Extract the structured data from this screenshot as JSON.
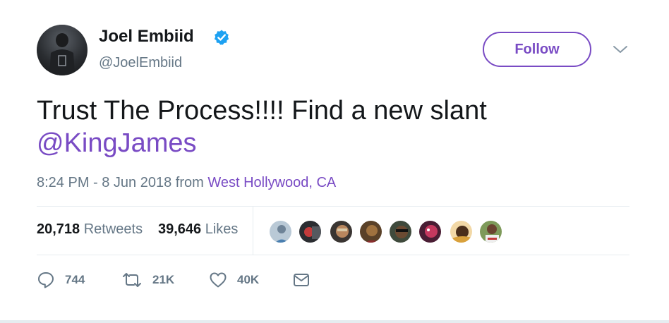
{
  "author": {
    "display_name": "Joel Embiid",
    "handle": "@JoelEmbiid",
    "verified": true,
    "avatar_icon": "user-avatar"
  },
  "follow_button": {
    "label": "Follow"
  },
  "menu_caret_icon": "chevron-down-icon",
  "tweet": {
    "text": "Trust The Process!!!! Find a new slant",
    "mention": "@KingJames"
  },
  "meta": {
    "time": "8:24 PM - 8 Jun 2018",
    "from_label": "from",
    "location": "West Hollywood, CA"
  },
  "stats": {
    "retweets_count": "20,718",
    "retweets_label": "Retweets",
    "likes_count": "39,646",
    "likes_label": "Likes"
  },
  "likers": [
    {
      "name": "liker-avatar-1",
      "color": "#9fb4c8"
    },
    {
      "name": "liker-avatar-2",
      "color": "#3b3e44"
    },
    {
      "name": "liker-avatar-3",
      "color": "#6b5a4e"
    },
    {
      "name": "liker-avatar-4",
      "color": "#8a6a3a"
    },
    {
      "name": "liker-avatar-5",
      "color": "#2f3a2e"
    },
    {
      "name": "liker-avatar-6",
      "color": "#7a2b4a"
    },
    {
      "name": "liker-avatar-7",
      "color": "#c58a3d"
    },
    {
      "name": "liker-avatar-8",
      "color": "#6f8a4e"
    }
  ],
  "actions": {
    "reply_count": "744",
    "retweet_count": "21K",
    "like_count": "40K",
    "icons": [
      "reply-icon",
      "retweet-icon",
      "heart-icon",
      "direct-message-icon"
    ]
  },
  "colors": {
    "accent": "#794bc4",
    "verified_badge": "#1da1f2",
    "secondary_text": "#657786",
    "divider": "#e6ecf0"
  }
}
